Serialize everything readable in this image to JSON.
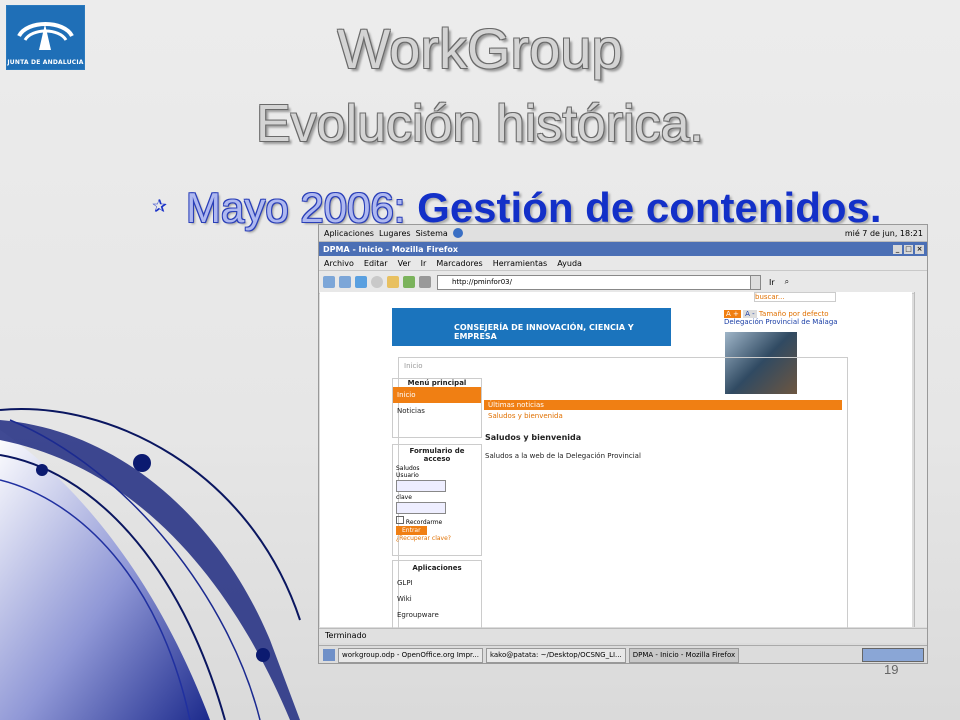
{
  "logo": {
    "text": "JUNTA DE ANDALUCIA"
  },
  "title": {
    "line1": "WorkGroup",
    "line2": "Evolución histórica."
  },
  "bullet": {
    "lead": "Mayo 2006:",
    "strong": "Gestión de contenidos",
    "end": "."
  },
  "slide_number": "19",
  "screenshot": {
    "gnome_menu": [
      "Aplicaciones",
      "Lugares",
      "Sistema"
    ],
    "clock": "mié  7 de jun, 18:21",
    "window_title": "DPMA - Inicio - Mozilla Firefox",
    "menubar": [
      "Archivo",
      "Editar",
      "Ver",
      "Ir",
      "Marcadores",
      "Herramientas",
      "Ayuda"
    ],
    "url": "http://pminfor03/",
    "go": "Ir",
    "status": "Terminado",
    "taskbar": [
      "workgroup.odp - OpenOffice.org Impr...",
      "kako@patata: ~/Desktop/OCSNG_LI...",
      "DPMA - Inicio - Mozilla Firefox"
    ],
    "page": {
      "banner": "CONSEJERÍA DE INNOVACIÓN, CIENCIA Y EMPRESA",
      "search": "buscar...",
      "font_size": "Tamaño por defecto",
      "delegation": "Delegación Provincial de Málaga",
      "breadcrumb": "Inicio",
      "menu_title": "Menú principal",
      "menu_items": [
        "Inicio",
        "Noticias"
      ],
      "form_title": "Formulario de acceso",
      "form_saludos": "Saludos",
      "form_user": "Usuario",
      "form_key": "clave",
      "form_remember": "Recordarme",
      "form_enter": "Entrar",
      "form_recover": "¿Recuperar clave?",
      "apps_title": "Aplicaciones",
      "apps": [
        "GLPI",
        "Wiki",
        "Egroupware"
      ],
      "news_header": "Últimas noticias",
      "news_item": "Saludos y bienvenida",
      "article_title": "Saludos y bienvenida",
      "article_text": "Saludos a la web de la Delegación Provincial"
    }
  },
  "colors": {
    "accent_blue": "#1330c8",
    "orange": "#f07f13",
    "banner": "#1b74bd"
  }
}
